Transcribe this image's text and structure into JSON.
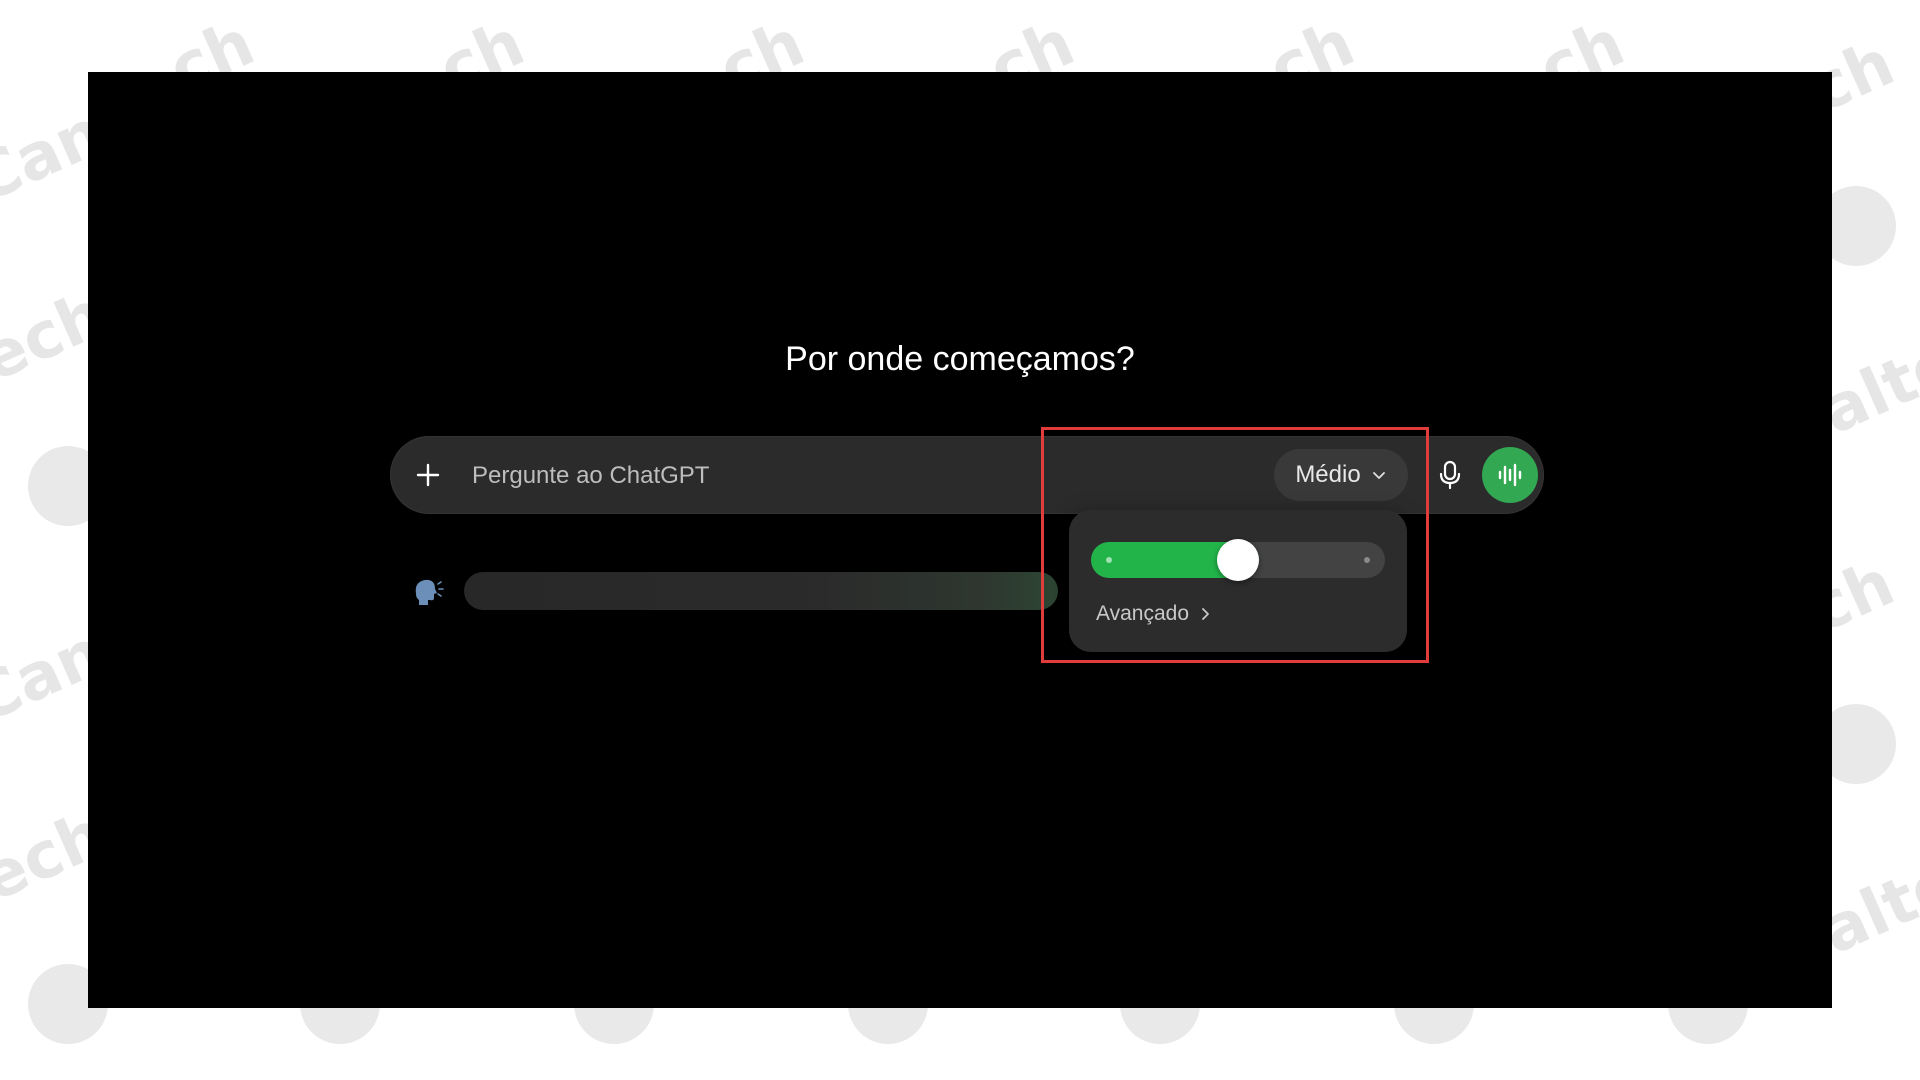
{
  "screen": {
    "headline": "Por onde começamos?"
  },
  "composer": {
    "add_icon": "plus-icon",
    "placeholder": "Pergunte ao ChatGPT",
    "model_select": {
      "label": "Médio",
      "icon": "chevron-down-icon"
    },
    "mic_icon": "microphone-icon",
    "voice_icon": "voice-waveform-icon"
  },
  "popover": {
    "slider_level": 0.5,
    "advanced_label": "Avançado",
    "advanced_icon": "chevron-right-icon"
  },
  "suggestion": {
    "icon": "speaking-head-icon"
  },
  "colors": {
    "screen_bg": "#000000",
    "composer_bg": "#2b2b2b",
    "accent_green": "#22b449",
    "voice_button": "#33a852",
    "highlight_border": "#e03c3c"
  }
}
